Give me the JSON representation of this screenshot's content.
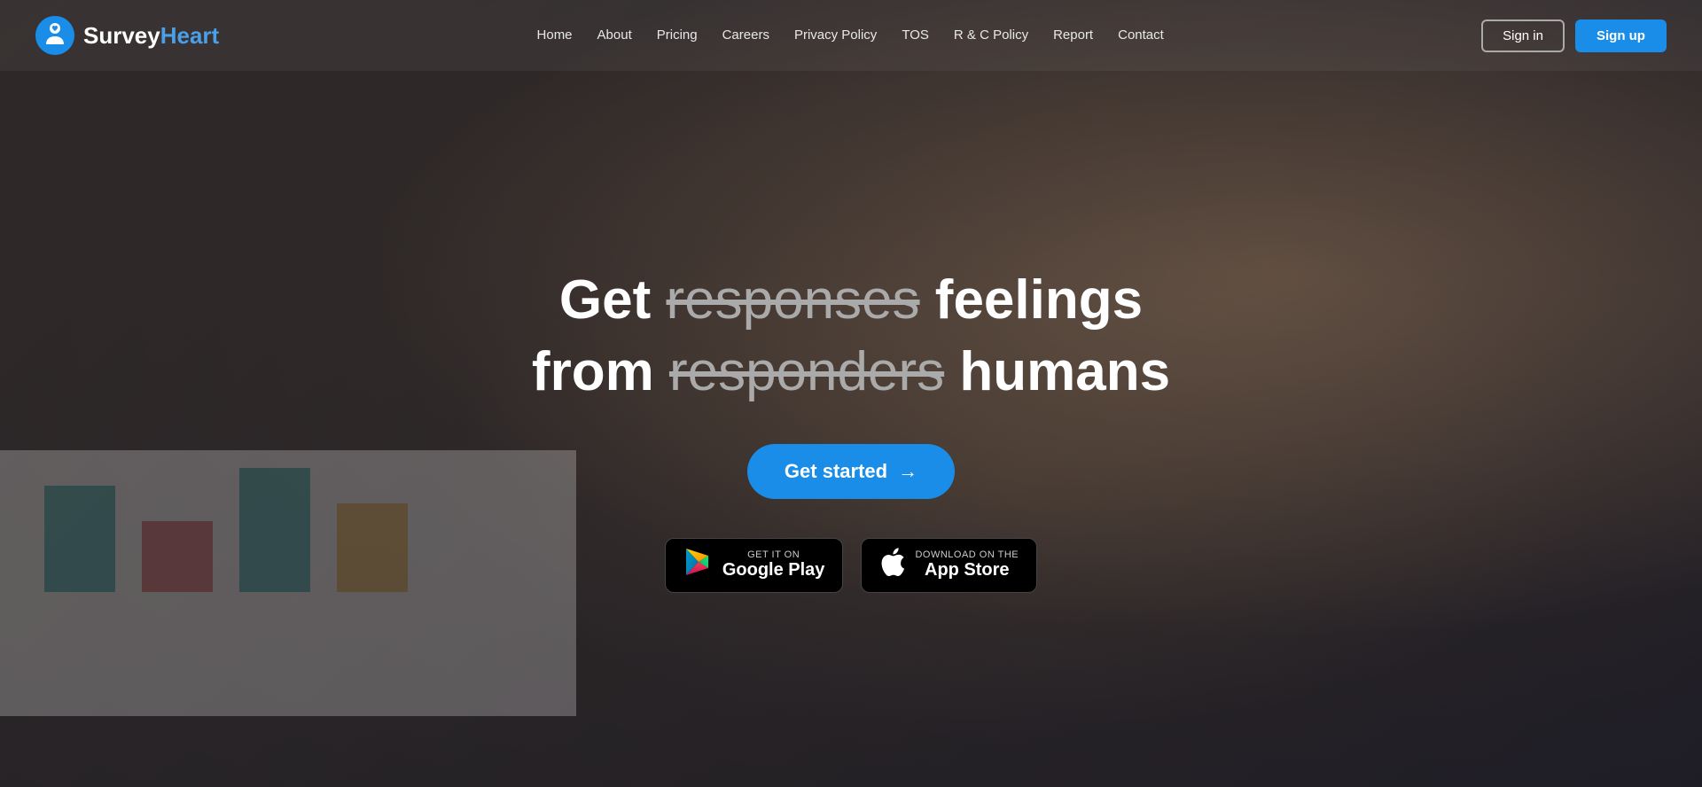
{
  "brand": {
    "logo_text_survey": "Survey",
    "logo_text_heart": "Heart",
    "full_name": "SurveyHeart"
  },
  "navbar": {
    "links": [
      {
        "id": "home",
        "label": "Home",
        "href": "#"
      },
      {
        "id": "about",
        "label": "About",
        "href": "#"
      },
      {
        "id": "pricing",
        "label": "Pricing",
        "href": "#"
      },
      {
        "id": "careers",
        "label": "Careers",
        "href": "#"
      },
      {
        "id": "privacy",
        "label": "Privacy Policy",
        "href": "#"
      },
      {
        "id": "tos",
        "label": "TOS",
        "href": "#"
      },
      {
        "id": "rc",
        "label": "R & C Policy",
        "href": "#"
      },
      {
        "id": "report",
        "label": "Report",
        "href": "#"
      },
      {
        "id": "contact",
        "label": "Contact",
        "href": "#"
      }
    ],
    "signin_label": "Sign in",
    "signup_label": "Sign up"
  },
  "hero": {
    "line1_prefix": "Get",
    "line1_strikethrough": "responses",
    "line1_suffix": "feelings",
    "line2_prefix": "from",
    "line2_strikethrough": "responders",
    "line2_suffix": "humans",
    "cta_label": "Get started",
    "cta_arrow": "→"
  },
  "stores": {
    "google_play": {
      "sub": "GET IT ON",
      "name": "Google Play",
      "aria": "Get it on Google Play"
    },
    "app_store": {
      "sub": "Download on the",
      "name": "App Store",
      "aria": "Download on the App Store"
    }
  },
  "colors": {
    "accent_blue": "#1a8de8",
    "navbar_signin_border": "#aaaaaa"
  }
}
